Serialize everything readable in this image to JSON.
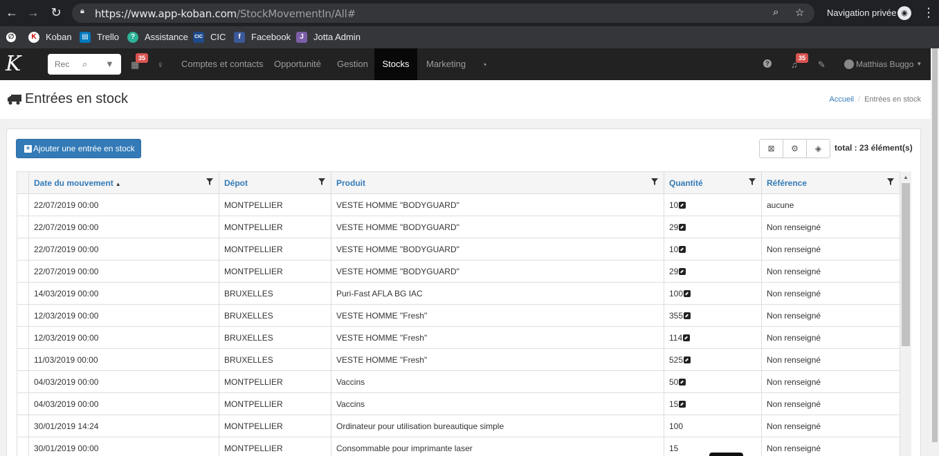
{
  "browser": {
    "url_host": "https://www.app-koban.com",
    "url_path": "/StockMovementIn/All#",
    "incognito_label": "Navigation privée",
    "bookmarks": [
      {
        "label": "",
        "icon": "bookmark-logo-icon"
      },
      {
        "label": "Koban",
        "icon": "koban-icon"
      },
      {
        "label": "Trello",
        "icon": "trello-icon"
      },
      {
        "label": "Assistance",
        "icon": "assistance-icon"
      },
      {
        "label": "CIC",
        "icon": "cic-icon"
      },
      {
        "label": "Facebook",
        "icon": "facebook-icon"
      },
      {
        "label": "Jotta Admin",
        "icon": "jotta-icon"
      }
    ]
  },
  "nav": {
    "search_placeholder": "Rec",
    "calendar_badge": "35",
    "notifications_badge": "35",
    "links": [
      "Comptes et contacts",
      "Opportunité",
      "Gestion",
      "Stocks",
      "Marketing"
    ],
    "active": "Stocks",
    "user": "Matthias Buggo"
  },
  "page": {
    "title": "Entrées en stock",
    "breadcrumb_home": "Accueil",
    "breadcrumb_current": "Entrées en stock",
    "add_button": "Ajouter une entrée en stock",
    "total": "total : 23 élément(s)"
  },
  "table": {
    "columns": [
      "Date du mouvement",
      "Dépot",
      "Produit",
      "Quantité",
      "Référence"
    ],
    "rows": [
      {
        "date": "22/07/2019 00:00",
        "depot": "MONTPELLIER",
        "produit": "VESTE HOMME \"BODYGUARD\"",
        "qty": "10",
        "link": true,
        "ref": "aucune"
      },
      {
        "date": "22/07/2019 00:00",
        "depot": "MONTPELLIER",
        "produit": "VESTE HOMME \"BODYGUARD\"",
        "qty": "29",
        "link": true,
        "ref": "Non renseigné"
      },
      {
        "date": "22/07/2019 00:00",
        "depot": "MONTPELLIER",
        "produit": "VESTE HOMME \"BODYGUARD\"",
        "qty": "10",
        "link": true,
        "ref": "Non renseigné"
      },
      {
        "date": "22/07/2019 00:00",
        "depot": "MONTPELLIER",
        "produit": "VESTE HOMME \"BODYGUARD\"",
        "qty": "29",
        "link": true,
        "ref": "Non renseigné"
      },
      {
        "date": "14/03/2019 00:00",
        "depot": "BRUXELLES",
        "produit": "Puri-Fast AFLA BG IAC",
        "qty": "100",
        "link": true,
        "ref": "Non renseigné"
      },
      {
        "date": "12/03/2019 00:00",
        "depot": "BRUXELLES",
        "produit": "VESTE HOMME \"Fresh\"",
        "qty": "355",
        "link": true,
        "ref": "Non renseigné"
      },
      {
        "date": "12/03/2019 00:00",
        "depot": "BRUXELLES",
        "produit": "VESTE HOMME \"Fresh\"",
        "qty": "114",
        "link": true,
        "ref": "Non renseigné"
      },
      {
        "date": "11/03/2019 00:00",
        "depot": "BRUXELLES",
        "produit": "VESTE HOMME \"Fresh\"",
        "qty": "525",
        "link": true,
        "ref": "Non renseigné"
      },
      {
        "date": "04/03/2019 00:00",
        "depot": "MONTPELLIER",
        "produit": "Vaccins",
        "qty": "50",
        "link": true,
        "ref": "Non renseigné"
      },
      {
        "date": "04/03/2019 00:00",
        "depot": "MONTPELLIER",
        "produit": "Vaccins",
        "qty": "15",
        "link": true,
        "ref": "Non renseigné"
      },
      {
        "date": "30/01/2019 14:24",
        "depot": "MONTPELLIER",
        "produit": "Ordinateur pour utilisation bureautique simple",
        "qty": "100",
        "link": false,
        "ref": "Non renseigné"
      },
      {
        "date": "30/01/2019 00:00",
        "depot": "MONTPELLIER",
        "produit": "Consommable pour imprimante laser",
        "qty": "15",
        "link": false,
        "ref": "Non renseigné"
      }
    ]
  },
  "colors": {
    "primary": "#337ab7",
    "navbar": "#222222",
    "badge": "#d9534f"
  }
}
